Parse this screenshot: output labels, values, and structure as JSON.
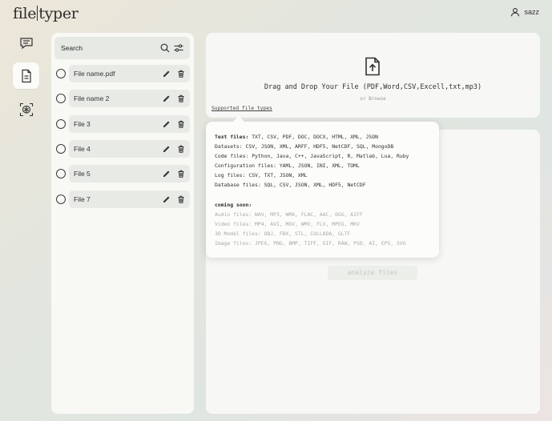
{
  "app": {
    "logo_left": "file",
    "logo_right": "typer",
    "user": "sazz"
  },
  "files": {
    "search_placeholder": "Search",
    "items": [
      {
        "name": "File name.pdf"
      },
      {
        "name": "File name 2"
      },
      {
        "name": "File 3"
      },
      {
        "name": "File 4"
      },
      {
        "name": "File 5"
      },
      {
        "name": "File 7"
      }
    ]
  },
  "upload": {
    "drag_text": "Drag and Drop Your File (PDF,Word,CSV,Excell,txt,mp3)",
    "browse": "or Browse",
    "supported_link": "Supported file types",
    "analyze": "analyze files"
  },
  "tooltip": {
    "lines": [
      {
        "label": "Text files:",
        "value": "TXT, CSV, PDF, DOC, DOCX, HTML, XML, JSON"
      },
      {
        "label": "Datasets:",
        "value": "CSV, JSON, XML, ARFF, HDF5, NetCDF, SQL, MongoDB"
      },
      {
        "label": "Code files:",
        "value": "Python, Java, C++, JavaScript, R, Matlab, Lua, Ruby"
      },
      {
        "label": "Configuration files:",
        "value": "YAML, JSON, INI, XML, TOML"
      },
      {
        "label": "Log files:",
        "value": "CSV, TXT, JSON, XML"
      },
      {
        "label": "Database files:",
        "value": "SQL, CSV, JSON, XML, HDF5, NetCDF"
      }
    ],
    "coming_soon_label": "coming soon:",
    "soon": [
      {
        "label": "Audio files:",
        "value": "WAV, MP3, WMA, FLAC, AAC, OGG, AIFF"
      },
      {
        "label": "Video files:",
        "value": "MP4, AVI, MOV, WMV, FLV, MPEG, MKV"
      },
      {
        "label": "3D Model files:",
        "value": "OBJ, FBX, STL, COLLADA, GLTF"
      },
      {
        "label": "Image files:",
        "value": "JPEG, PNG, BMP, TIFF, GIF, RAW, PSD, AI, EPS, SVG"
      }
    ]
  }
}
